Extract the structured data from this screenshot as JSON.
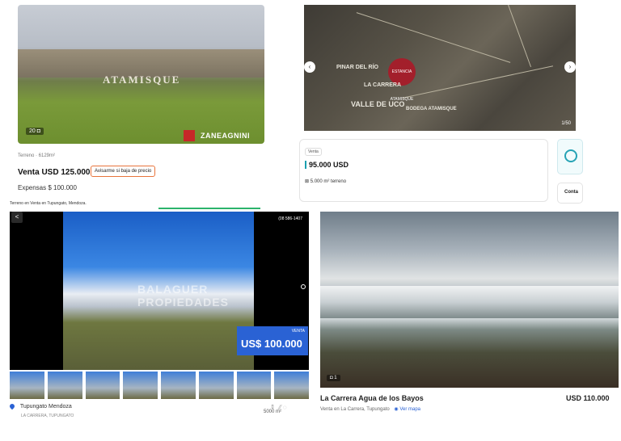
{
  "listing_a": {
    "photo_count": "20",
    "sign_text": "ATAMISQUE",
    "brand": "ZANEAGNINI",
    "meta": "Terreno · 6129m²",
    "price": "Venta USD 125.000",
    "alert_button": "Avisarme si baja de precio",
    "expensas": "Expensas $ 100.000"
  },
  "listing_b": {
    "map_labels": {
      "logo": "ESTANCIA ATAMISQUE",
      "la_carrera": "LA CARRERA",
      "valle": "VALLE DE UCO",
      "bodega": "BODEGA ATAMISQUE",
      "pinar": "PINAR DEL RÍO"
    },
    "nav_prev": "‹",
    "nav_next": "›",
    "photo_count": "1/50",
    "tag": "Venta",
    "price": "95.000 USD",
    "surface": "5.000 m² terreno",
    "contact_label": "Conta"
  },
  "listing_c": {
    "caption": "Terreno en Venta en Tupungato, Mendoza.",
    "phone": "(08 586-1407",
    "watermark": "BALAGUER PROPIEDADES",
    "price_label": "VENTA",
    "price": "US$ 100.000",
    "location": "Tupungato Mendoza",
    "sub_location": "LA CARRERA, TUPUNGATO",
    "area": "5000 m²",
    "share_icon": "<",
    "thumbnails": 8
  },
  "listing_d": {
    "photo_count": "1",
    "title": "La Carrera Agua de los Bayos",
    "subtitle": "Venta en La Carrera, Tupungato",
    "map_link": "Ver mapa",
    "price": "USD 110.000"
  },
  "colors": {
    "accent_orange": "#e8743b",
    "accent_teal": "#26a3b5",
    "accent_blue": "#2a62d4",
    "accent_green": "#2bb36b",
    "brand_red": "#c62828"
  }
}
